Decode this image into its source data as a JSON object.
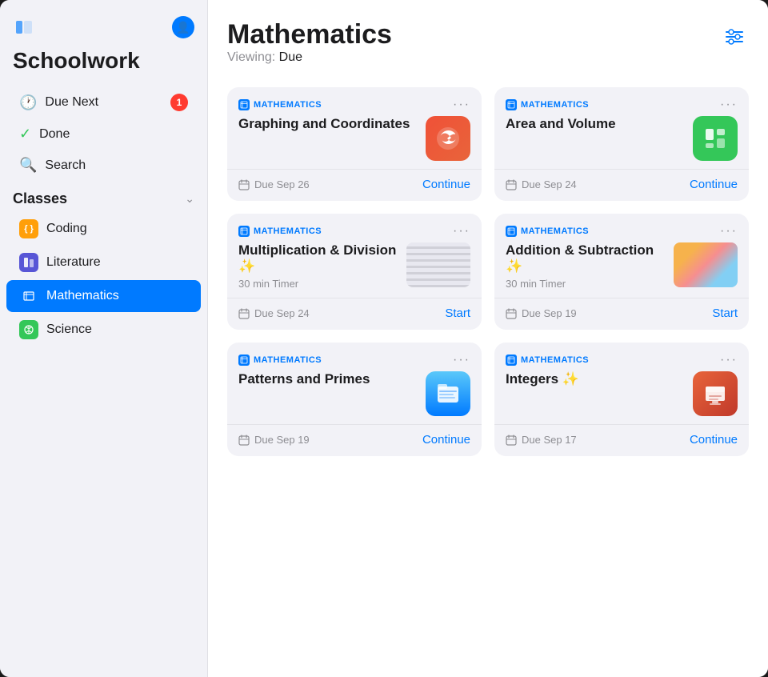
{
  "sidebar": {
    "app_title": "Schoolwork",
    "nav_items": [
      {
        "id": "due-next",
        "label": "Due Next",
        "icon": "🕐",
        "badge": "1"
      },
      {
        "id": "done",
        "label": "Done",
        "icon": "✓"
      },
      {
        "id": "search",
        "label": "Search",
        "icon": "🔍"
      }
    ],
    "classes_section": {
      "title": "Classes",
      "items": [
        {
          "id": "coding",
          "label": "Coding",
          "color": "#ff9f0a"
        },
        {
          "id": "literature",
          "label": "Literature",
          "color": "#5856d6"
        },
        {
          "id": "mathematics",
          "label": "Mathematics",
          "color": "#007aff",
          "active": true
        },
        {
          "id": "science",
          "label": "Science",
          "color": "#34c759"
        }
      ]
    }
  },
  "main": {
    "page_title": "Mathematics",
    "viewing_label": "Viewing:",
    "viewing_filter": "Due",
    "cards": [
      {
        "id": "graphing",
        "subject": "MATHEMATICS",
        "title": "Graphing and Coordinates",
        "app_icon_type": "swift",
        "due_date": "Due Sep 26",
        "action": "Continue"
      },
      {
        "id": "area-volume",
        "subject": "MATHEMATICS",
        "title": "Area and Volume",
        "app_icon_type": "numbers",
        "due_date": "Due Sep 24",
        "action": "Continue"
      },
      {
        "id": "multiplication",
        "subject": "MATHEMATICS",
        "title": "Multiplication & Division ✨",
        "timer": "30 min Timer",
        "app_icon_type": "thumbnail",
        "due_date": "Due Sep 24",
        "action": "Start"
      },
      {
        "id": "addition",
        "subject": "MATHEMATICS",
        "title": "Addition & Subtraction ✨",
        "timer": "30 min Timer",
        "app_icon_type": "thumbnail-color",
        "due_date": "Due Sep 19",
        "action": "Start"
      },
      {
        "id": "patterns",
        "subject": "MATHEMATICS",
        "title": "Patterns and Primes",
        "app_icon_type": "files",
        "due_date": "Due Sep 19",
        "action": "Continue"
      },
      {
        "id": "integers",
        "subject": "MATHEMATICS",
        "title": "Integers ✨",
        "app_icon_type": "keynote",
        "due_date": "Due Sep 17",
        "action": "Continue"
      }
    ]
  }
}
